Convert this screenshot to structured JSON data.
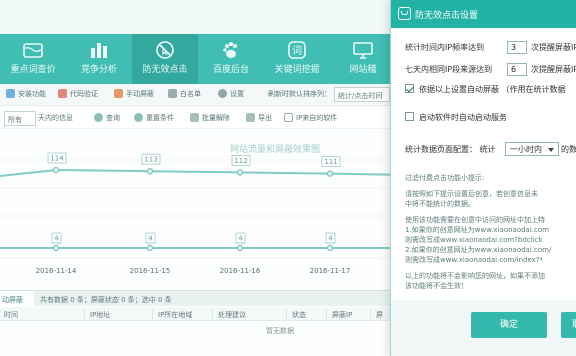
{
  "nav": {
    "items": [
      {
        "label": "重点词查价",
        "icon": "wallet-icon"
      },
      {
        "label": "竞争分析",
        "icon": "building-chart-icon"
      },
      {
        "label": "防无效点击",
        "icon": "no-click-icon",
        "active": true
      },
      {
        "label": "百度后台",
        "icon": "baidu-paw-icon"
      },
      {
        "label": "关键词挖掘",
        "icon": "keyword-icon"
      },
      {
        "label": "网站稽",
        "icon": "monitor-icon"
      }
    ]
  },
  "toolbar": {
    "items": [
      "安装功能",
      "代码验证",
      "手动屏蔽",
      "白名单",
      "设置"
    ],
    "sort_label": "刷新时默认排序列：",
    "sort_value": "统计/点击时间"
  },
  "filter": {
    "scope_value": "所有",
    "days_label": "天内的信息",
    "query": "查询",
    "reset": "重置条件",
    "batch_unblock": "批量解除",
    "export": "导出",
    "ip_from": "IP来自的软件"
  },
  "chart_data": {
    "type": "line",
    "title": "网站流量和屏蔽效果图",
    "categories": [
      "2016-11-14",
      "2016-11-15",
      "2016-11-16",
      "2016-11-17"
    ],
    "series": [
      {
        "values": [
          114,
          113,
          112,
          111
        ],
        "color": "#6fc5bd"
      },
      {
        "values": [
          4,
          4,
          4,
          4
        ],
        "color": "#6fc5bd"
      }
    ],
    "top_labels": [
      "114",
      "113",
      "112",
      "111"
    ],
    "bottom_labels": [
      "4",
      "4",
      "4",
      "4"
    ]
  },
  "grid": {
    "tab": "动屏蔽",
    "summary": "共有数据 0 条；屏蔽状态 0 条；选中 0 条",
    "headers": [
      "时间",
      "IP地址",
      "IP所在地域",
      "处理建议",
      "状态",
      "屏蔽IP",
      "屏"
    ],
    "empty_text": "暂无数据"
  },
  "dialog": {
    "title": "防无效点击设置",
    "rule1": {
      "prefix": "统计时间内IP频率达到",
      "value": "3",
      "suffix": "次提醒屏蔽IP"
    },
    "rule2": {
      "prefix": "七天内相同IP段来源达到",
      "value": "6",
      "suffix": "次提醒屏蔽IP"
    },
    "auto_block": {
      "label": "依据以上设置自动屏蔽  （作用在统计数据",
      "checked": true
    },
    "auto_start": {
      "label": "启动软件时自动启动服务",
      "checked": false
    },
    "page_config": {
      "prefix": "统计数据页面配置：  统计",
      "value": "一小时内",
      "suffix": "的数"
    },
    "hint_lines": [
      "过滤付费点击功能小提示:",
      "",
      "请按照如下提示设置后创意，若创意信息未",
      "中将不能统计的数据。",
      "",
      "使用该功能需要在创意中访问的网址中加上特",
      "1.如果你的创意网址为www.xiaonaodai.com",
      "     则需改写成www.xiaonaodai.com?bdclick",
      "2.如果你的创意网址为www.xiaonaodai.com/",
      "     则需改写成www.xiaonaodai.com/index?*",
      "",
      "以上的功能将不会影响您的网址，如果不添加",
      "该功能将不会生效！"
    ],
    "ok": "确定",
    "cancel": "取消"
  }
}
